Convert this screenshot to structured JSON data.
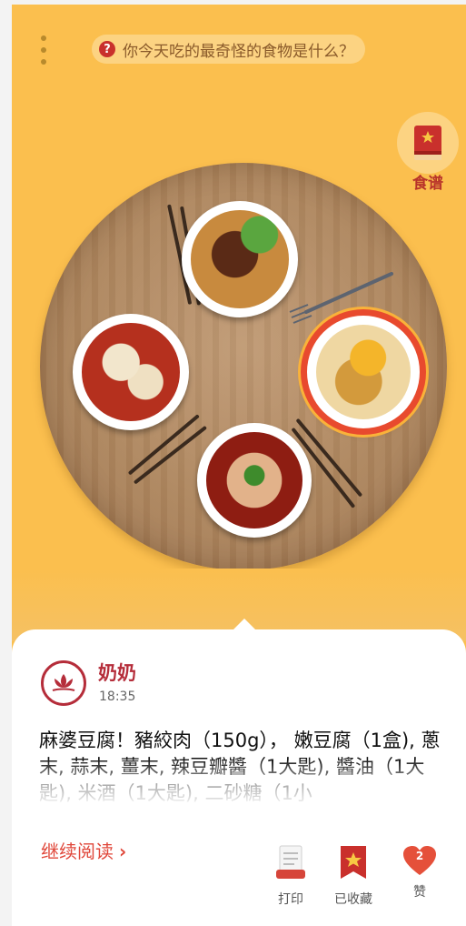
{
  "header": {
    "question_icon": "question-icon",
    "question_text": "你今天吃的最奇怪的食物是什么？"
  },
  "recipe_button": {
    "label": "食谱",
    "icon": "recipe-book-icon"
  },
  "dishes": [
    {
      "name": "beef-noodles",
      "selected": false
    },
    {
      "name": "dumplings",
      "selected": false
    },
    {
      "name": "pie",
      "selected": true
    },
    {
      "name": "mapo-tofu",
      "selected": false
    }
  ],
  "post": {
    "author": "奶奶",
    "time": "18:35",
    "content": "麻婆豆腐！豬絞肉（150g），  嫩豆腐（1盒), 蔥末, 蒜末, 薑末, 辣豆瓣醬（1大匙), 醬油（1大匙), 米酒（1大匙),   二砂糖（1小",
    "read_more": "继续阅读"
  },
  "actions": {
    "print": "打印",
    "saved": "已收藏",
    "like": "赞",
    "like_count": "2"
  },
  "colors": {
    "background": "#fbbf4e",
    "accent_red": "#b52d3a",
    "link_red": "#e0473a"
  }
}
